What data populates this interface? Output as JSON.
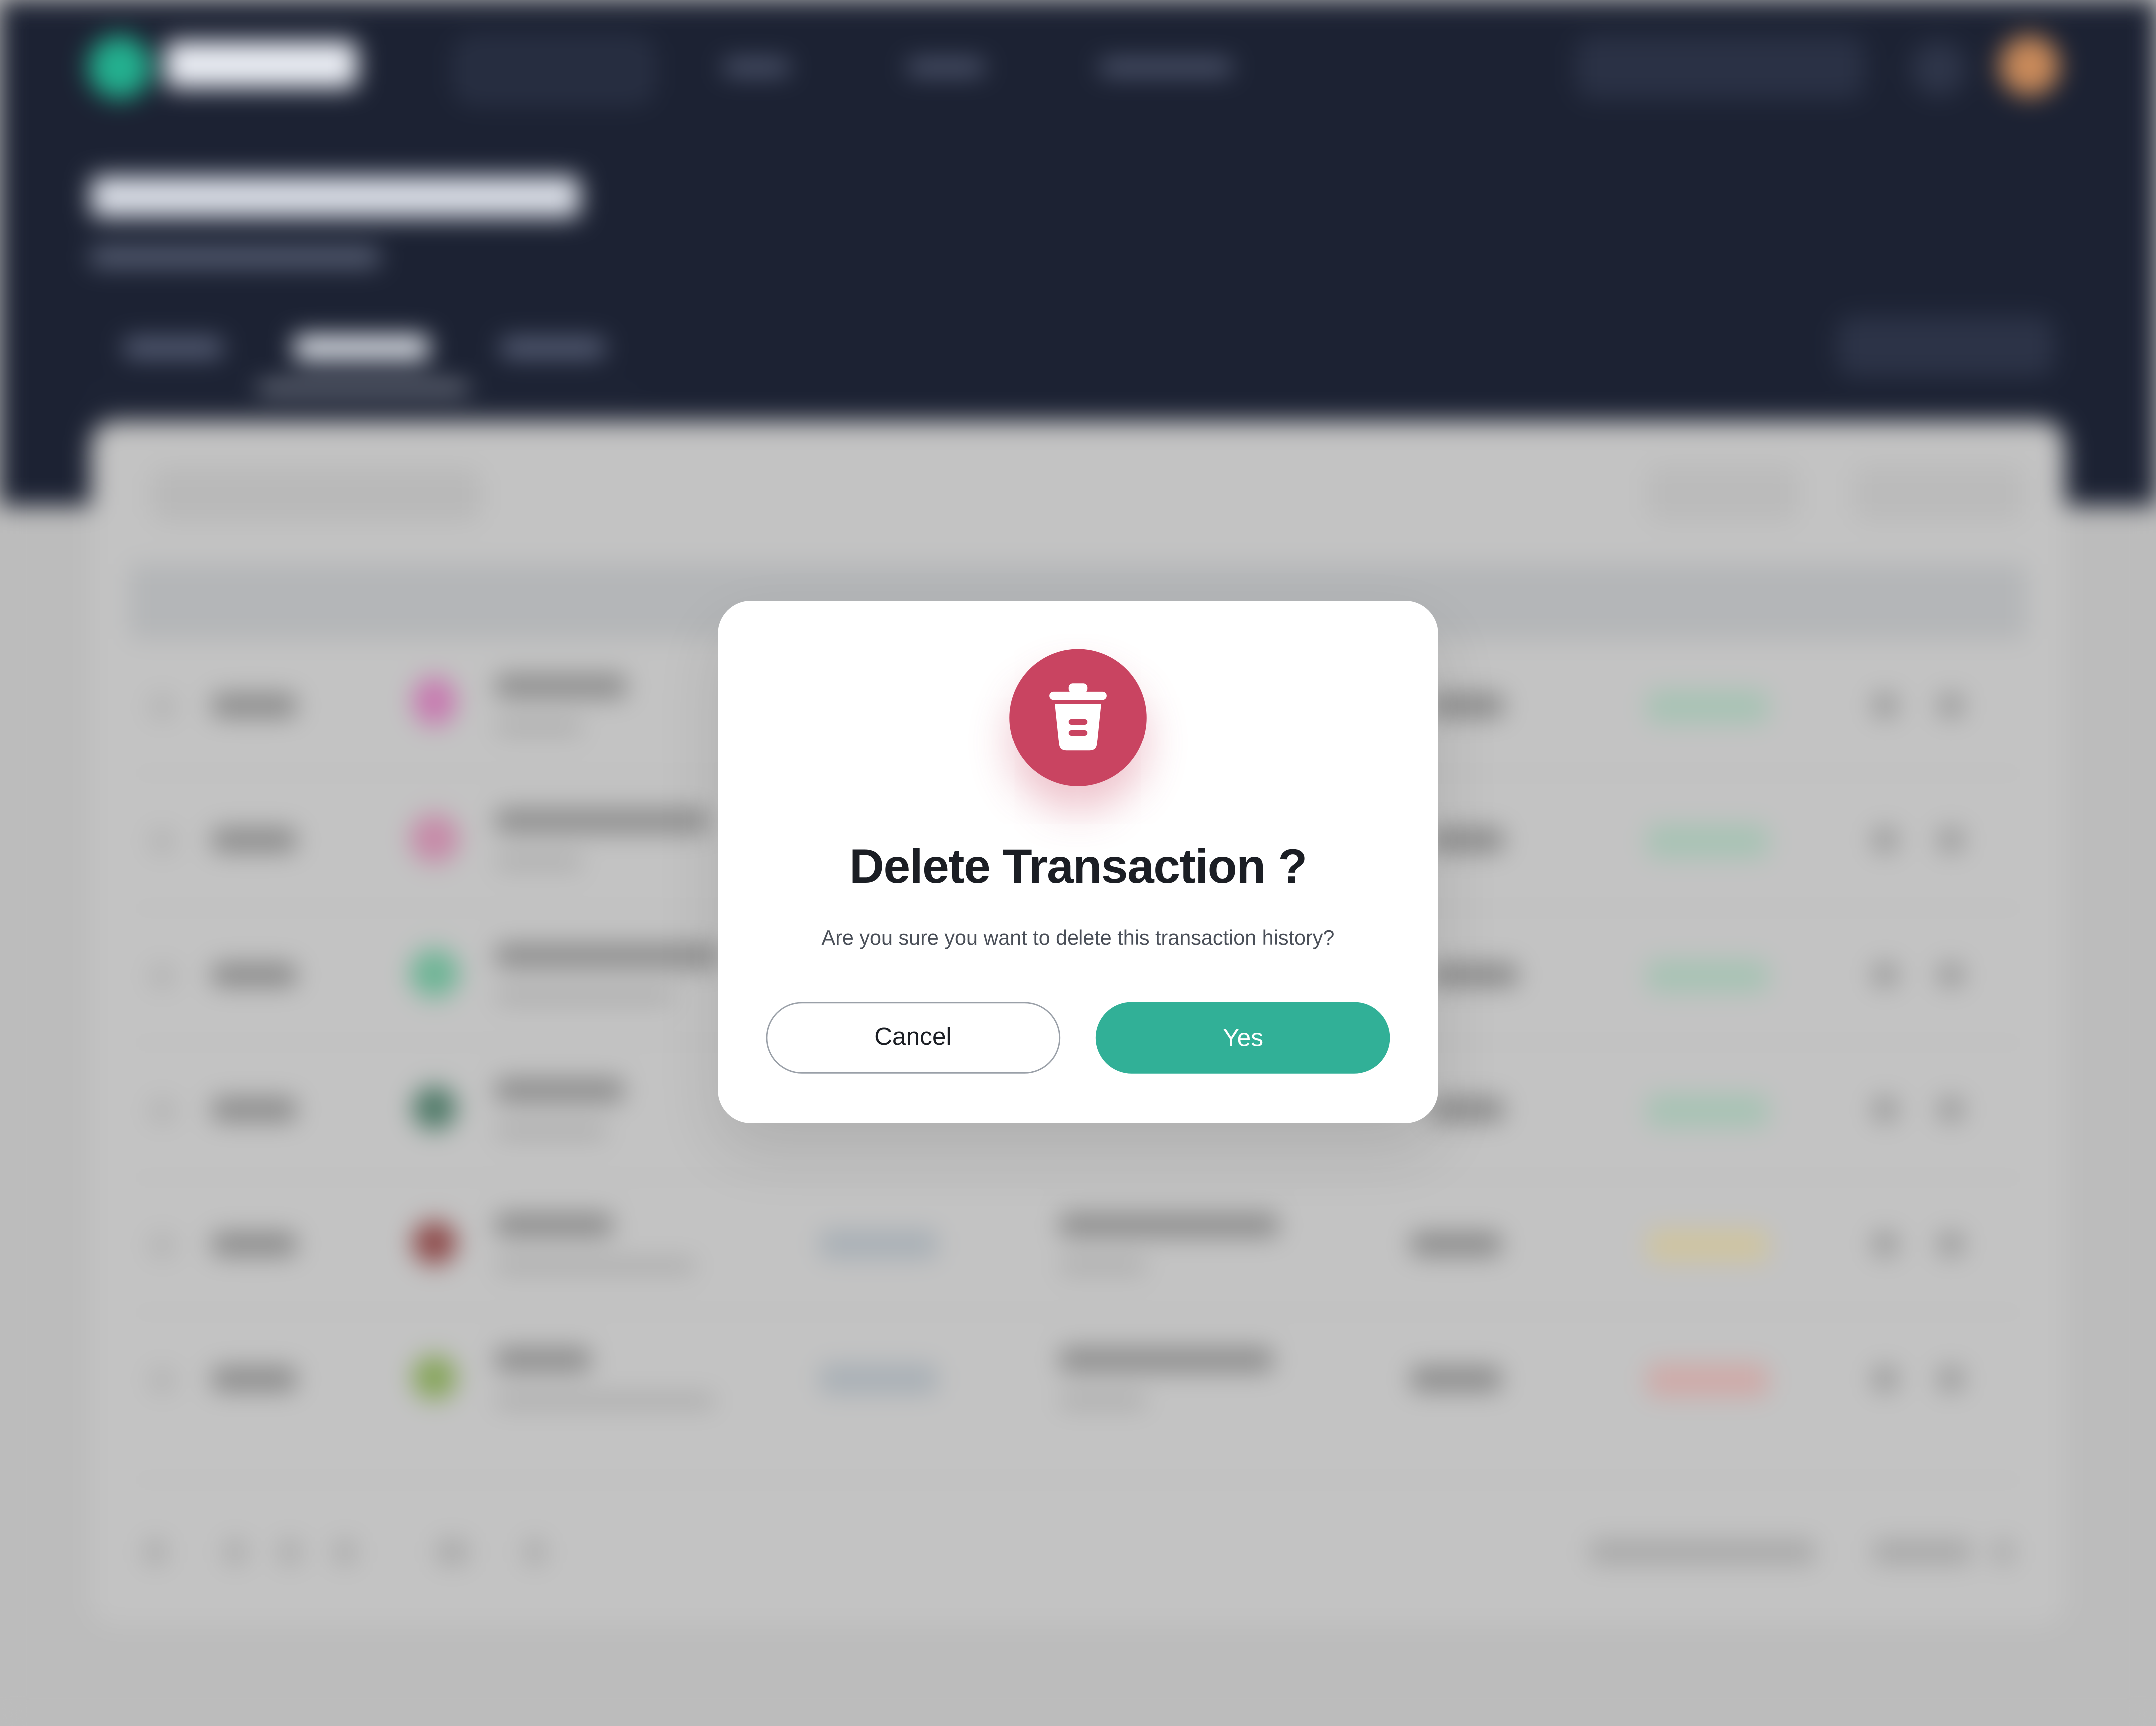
{
  "modal": {
    "title": "Delete Transaction ?",
    "message": "Are you sure you want to delete this transaction history?",
    "cancel_label": "Cancel",
    "confirm_label": "Yes",
    "icon": "trash-icon"
  },
  "colors": {
    "danger": "#c94461",
    "primary": "#31b097",
    "header_bg": "#1c2233",
    "overlay": "#bdbdbd"
  }
}
